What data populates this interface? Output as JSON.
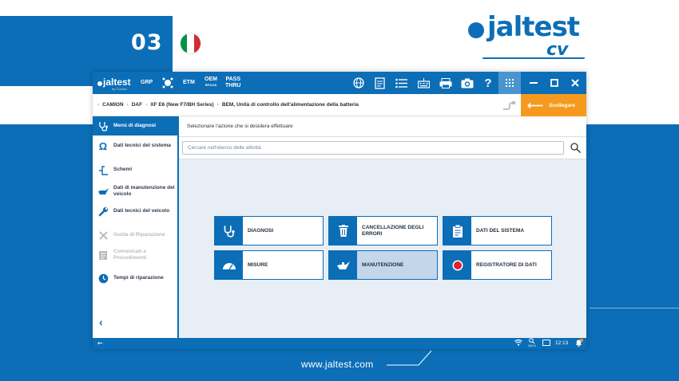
{
  "promo": {
    "step_number": "03",
    "flag_colors": [
      "#009246",
      "#ffffff",
      "#ce2b37"
    ],
    "brand_name": "jaltest",
    "brand_sub": "cv",
    "website": "www.jaltest.com",
    "accent_color": "#0c6eb6"
  },
  "topbar": {
    "logo": "jaltest",
    "logo_sub": "by COJALI",
    "items": [
      {
        "label": "GRP"
      },
      {
        "label": "ETM"
      },
      {
        "label": "OEM",
        "sub": "RP1210"
      },
      {
        "label": "PASS",
        "sub": "THRU"
      }
    ],
    "icons": [
      "target-icon",
      "globe-icon",
      "document-icon",
      "list-icon",
      "keyboard-icon",
      "printer-icon",
      "camera-icon",
      "help-icon",
      "grid-icon"
    ],
    "window_controls": [
      "minimize-icon",
      "maximize-icon",
      "close-icon"
    ]
  },
  "breadcrumb": {
    "items": [
      "CAMION",
      "DAF",
      "XF E6 (New F7/BH Series)",
      "BEM, Unità di controllo dell'alimentazione della batteria"
    ],
    "disconnect_label": "Scollegare",
    "disconnect_color": "#f59a1e"
  },
  "sidebar": {
    "items": [
      {
        "label": "Menù di diagnosi",
        "icon": "stethoscope-icon",
        "state": "active"
      },
      {
        "label": "Dati tecnici del sistema",
        "icon": "omega-icon",
        "state": "normal"
      },
      {
        "label": "Schemi",
        "icon": "circuit-icon",
        "state": "normal"
      },
      {
        "label": "Dati di manutenzione del veicolo",
        "icon": "oil-can-icon",
        "state": "normal"
      },
      {
        "label": "Dati tecnici del veicolo",
        "icon": "wrench-icon",
        "state": "normal"
      },
      {
        "label": "Guida di Riparazione",
        "icon": "tools-icon",
        "state": "disabled"
      },
      {
        "label": "Comunicati a Procedimenti",
        "icon": "notes-icon",
        "state": "disabled"
      },
      {
        "label": "Tempi di riparazione",
        "icon": "clock-icon",
        "state": "normal"
      }
    ]
  },
  "main": {
    "header": "Selezionare l'azione che si desidera effettuare",
    "search_placeholder": "Cercare nell'elenco delle attività",
    "actions": [
      {
        "label": "DIAGNOSI",
        "icon": "stethoscope-icon"
      },
      {
        "label": "CANCELLAZIONE DEGLI ERRORI",
        "icon": "trash-icon"
      },
      {
        "label": "DATI DEL SISTEMA",
        "icon": "clipboard-icon"
      },
      {
        "label": "MISURE",
        "icon": "gauge-icon"
      },
      {
        "label": "MANUTENZIONE",
        "icon": "oil-can-icon",
        "selected": true
      },
      {
        "label": "REGISTRATORE DI DATI",
        "icon": "record-icon"
      }
    ]
  },
  "statusbar": {
    "zoom": "100 %",
    "time": "12:13"
  }
}
